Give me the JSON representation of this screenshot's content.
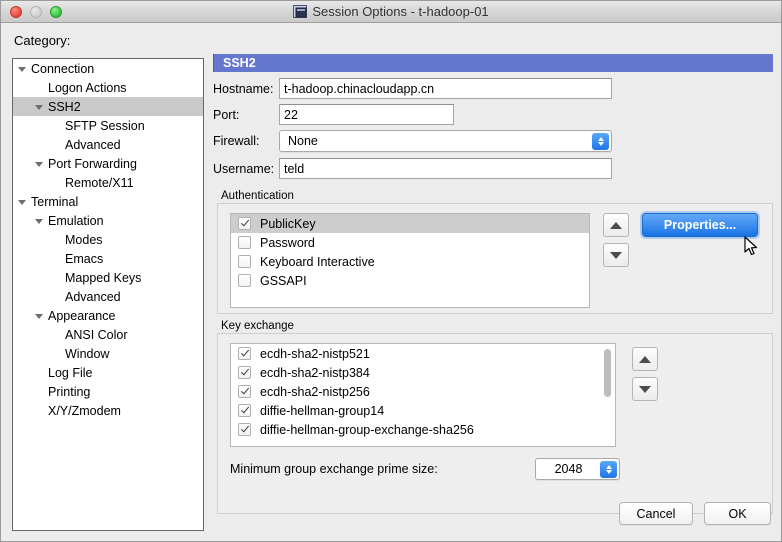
{
  "window": {
    "title": "Session Options - t-hadoop-01",
    "app_icon": "session-window-icon",
    "traffic_lights": {
      "close": "close-button",
      "minimize": "minimize-button",
      "zoom": "zoom-button"
    }
  },
  "sidebar": {
    "label": "Category:",
    "items": [
      {
        "label": "Connection",
        "indent": 0,
        "twisty": true,
        "selected": false
      },
      {
        "label": "Logon Actions",
        "indent": 1,
        "twisty": false,
        "selected": false
      },
      {
        "label": "SSH2",
        "indent": 1,
        "twisty": true,
        "selected": true
      },
      {
        "label": "SFTP Session",
        "indent": 2,
        "twisty": false,
        "selected": false
      },
      {
        "label": "Advanced",
        "indent": 2,
        "twisty": false,
        "selected": false
      },
      {
        "label": "Port Forwarding",
        "indent": 1,
        "twisty": true,
        "selected": false
      },
      {
        "label": "Remote/X11",
        "indent": 2,
        "twisty": false,
        "selected": false
      },
      {
        "label": "Terminal",
        "indent": 0,
        "twisty": true,
        "selected": false
      },
      {
        "label": "Emulation",
        "indent": 1,
        "twisty": true,
        "selected": false
      },
      {
        "label": "Modes",
        "indent": 2,
        "twisty": false,
        "selected": false
      },
      {
        "label": "Emacs",
        "indent": 2,
        "twisty": false,
        "selected": false
      },
      {
        "label": "Mapped Keys",
        "indent": 2,
        "twisty": false,
        "selected": false
      },
      {
        "label": "Advanced",
        "indent": 2,
        "twisty": false,
        "selected": false
      },
      {
        "label": "Appearance",
        "indent": 1,
        "twisty": true,
        "selected": false
      },
      {
        "label": "ANSI Color",
        "indent": 2,
        "twisty": false,
        "selected": false
      },
      {
        "label": "Window",
        "indent": 2,
        "twisty": false,
        "selected": false
      },
      {
        "label": "Log File",
        "indent": 1,
        "twisty": false,
        "selected": false
      },
      {
        "label": "Printing",
        "indent": 1,
        "twisty": false,
        "selected": false
      },
      {
        "label": "X/Y/Zmodem",
        "indent": 1,
        "twisty": false,
        "selected": false
      }
    ]
  },
  "panel": {
    "banner": "SSH2",
    "fields": {
      "hostname_label": "Hostname:",
      "hostname_value": "t-hadoop.chinacloudapp.cn",
      "port_label": "Port:",
      "port_value": "22",
      "firewall_label": "Firewall:",
      "firewall_value": "None",
      "username_label": "Username:",
      "username_value": "teld"
    },
    "authentication": {
      "title": "Authentication",
      "items": [
        {
          "label": "PublicKey",
          "checked": true,
          "selected": true
        },
        {
          "label": "Password",
          "checked": false,
          "selected": false
        },
        {
          "label": "Keyboard Interactive",
          "checked": false,
          "selected": false
        },
        {
          "label": "GSSAPI",
          "checked": false,
          "selected": false
        }
      ],
      "move_up": "move-up",
      "move_down": "move-down",
      "properties_label": "Properties..."
    },
    "key_exchange": {
      "title": "Key exchange",
      "items": [
        {
          "label": "ecdh-sha2-nistp521",
          "checked": true
        },
        {
          "label": "ecdh-sha2-nistp384",
          "checked": true
        },
        {
          "label": "ecdh-sha2-nistp256",
          "checked": true
        },
        {
          "label": "diffie-hellman-group14",
          "checked": true
        },
        {
          "label": "diffie-hellman-group-exchange-sha256",
          "checked": true
        }
      ],
      "move_up": "move-up",
      "move_down": "move-down",
      "prime_label": "Minimum group exchange prime size:",
      "prime_value": "2048"
    }
  },
  "footer": {
    "cancel_label": "Cancel",
    "ok_label": "OK"
  },
  "colors": {
    "banner": "#6577cd",
    "default_button": "#2a7de8",
    "selection": "#c9c9c9"
  }
}
